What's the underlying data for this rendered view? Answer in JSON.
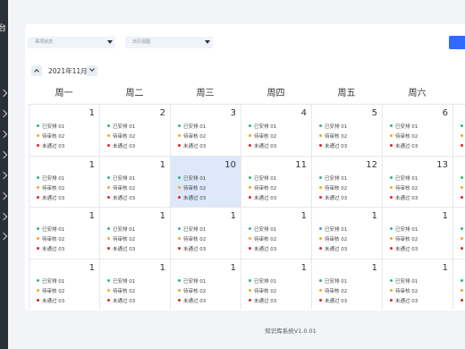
{
  "sidebar": {
    "logo": "台"
  },
  "filters": {
    "status": {
      "placeholder": "事项状态"
    },
    "view": {
      "placeholder": "日历视图"
    }
  },
  "calendar": {
    "month_label": "2021年11月",
    "weekdays": [
      "周一",
      "周二",
      "周三",
      "周四",
      "周五",
      "周六"
    ],
    "event_labels": [
      "已安排 01",
      "待审核 02",
      "未通过 03"
    ],
    "event_colors": [
      "#2dbb6b",
      "#f5a623",
      "#e02424"
    ],
    "weeks": [
      [
        "1",
        "2",
        "3",
        "4",
        "5",
        "6"
      ],
      [
        "1",
        "1",
        "10",
        "11",
        "12",
        "13"
      ],
      [
        "1",
        "1",
        "1",
        "1",
        "1",
        "1"
      ],
      [
        "1",
        "1",
        "1",
        "1",
        "1",
        "1"
      ]
    ],
    "selected": {
      "week": 1,
      "day": 2
    }
  },
  "footer": {
    "text": "知识库系统V1.0.01"
  }
}
